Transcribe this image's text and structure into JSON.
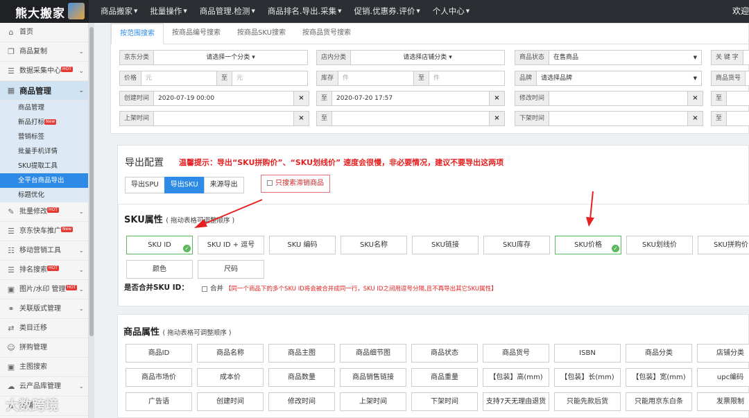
{
  "app": {
    "logo": "熊大搬家",
    "welcome": "欢迎"
  },
  "nav": [
    "商品搬家",
    "批量操作",
    "商品管理.检测",
    "商品排名.导出.采集",
    "促销.优惠券.评价",
    "个人中心"
  ],
  "sidebar": {
    "items": [
      {
        "label": "首页",
        "icon": "home-icon",
        "glyph": "⌂",
        "chevron": false,
        "hot": ""
      },
      {
        "label": "商品复制",
        "icon": "copy-icon",
        "glyph": "❐",
        "chevron": true,
        "hot": ""
      },
      {
        "label": "数据采集中心",
        "icon": "list-icon",
        "glyph": "☰",
        "chevron": true,
        "hot": "HOT"
      },
      {
        "label": "商品管理",
        "icon": "grid-icon",
        "glyph": "▦",
        "chevron": true,
        "hot": "",
        "active": true
      }
    ],
    "sub_items": [
      "商品管理",
      "新品打标",
      "营销标签",
      "批量手机详情",
      "SKU提取工具",
      "全平台商品导出",
      "标题优化"
    ],
    "sub_badge": "New",
    "items_after": [
      {
        "label": "批量修改",
        "icon": "wrench-icon",
        "glyph": "✎",
        "chevron": true,
        "hot": "HOT"
      },
      {
        "label": "京东快车推广",
        "icon": "list-icon",
        "glyph": "☰",
        "chevron": false,
        "hot": "New"
      },
      {
        "label": "移动营销工具",
        "icon": "sliders-icon",
        "glyph": "☷",
        "chevron": true,
        "hot": ""
      },
      {
        "label": "排名搜索",
        "icon": "list-icon",
        "glyph": "☰",
        "chevron": true,
        "hot": "HOT"
      },
      {
        "label": "图片/水印 管理",
        "icon": "image-icon",
        "glyph": "▣",
        "chevron": true,
        "hot": "HOT"
      },
      {
        "label": "关联版式管理",
        "icon": "link-icon",
        "glyph": "⚭",
        "chevron": true,
        "hot": ""
      },
      {
        "label": "类目迁移",
        "icon": "exchange-icon",
        "glyph": "⇄",
        "chevron": false,
        "hot": ""
      },
      {
        "label": "拼购管理",
        "icon": "users-icon",
        "glyph": "☺",
        "chevron": false,
        "hot": ""
      },
      {
        "label": "主图搜索",
        "icon": "picture-icon",
        "glyph": "▣",
        "chevron": false,
        "hot": ""
      },
      {
        "label": "云产品库管理",
        "icon": "cloud-icon",
        "glyph": "☁",
        "chevron": true,
        "hot": ""
      },
      {
        "label": "店铺",
        "icon": "store-icon",
        "glyph": "⌂",
        "chevron": false,
        "hot": ""
      }
    ]
  },
  "filters": {
    "tabs": [
      "按范围搜索",
      "按商品编号搜索",
      "按商品SKU搜索",
      "按商品货号搜索"
    ],
    "jd_category": {
      "label": "京东分类",
      "value": "请选择一个分类"
    },
    "shop_category": {
      "label": "店内分类",
      "value": "请选择店铺分类"
    },
    "status": {
      "label": "商品状态",
      "value": "在售商品"
    },
    "keyword": {
      "label": "关 键 字"
    },
    "price": {
      "label": "价格",
      "from_ph": "元",
      "to": "至",
      "to_ph": "元"
    },
    "stock": {
      "label": "库存",
      "from_ph": "件",
      "to": "至",
      "to_ph": "件"
    },
    "brand": {
      "label": "品牌",
      "value": "请选择品牌"
    },
    "sku_no": {
      "label": "商品货号"
    },
    "created": {
      "label": "创建时间",
      "from": "2020-07-19 00:00",
      "to": "至",
      "to_value": "2020-07-20 17:57"
    },
    "modified": {
      "label": "修改时间",
      "to": "至"
    },
    "listed": {
      "label": "上架时间",
      "to": "至"
    },
    "delisted": {
      "label": "下架时间",
      "to": "至"
    },
    "clear_glyph": "×"
  },
  "export": {
    "title": "导出配置",
    "tip": "温馨提示：导出“SKU拼购价”、“SKU划线价” 速度会很慢，非必要情况，建议不要导出这两项",
    "modes": [
      "导出SPU",
      "导出SKU",
      "来源导出"
    ],
    "active_mode": 1,
    "slow_only": "只搜索滞销商品",
    "sku_section": {
      "title": "SKU属性",
      "hint": "( 拖动表格可调整顺序 )"
    },
    "sku_attrs": [
      "SKU ID",
      "SKU ID + 逗号",
      "SKU 编码",
      "SKU名称",
      "SKU链接",
      "SKU库存",
      "SKU价格",
      "SKU划线价",
      "SKU拼购价",
      "颜色",
      "尺码"
    ],
    "sku_selected": [
      0,
      6
    ],
    "merge_label": "是否合并SKU ID：",
    "merge_option": "合并",
    "merge_note": "【同一个商品下的多个SKU ID将会被合并成同一行，SKU ID之间用逗号分隔,且不再导出其它SKU属性】"
  },
  "product": {
    "title": "商品属性",
    "hint": "( 拖动表格可调整顺序 )",
    "attrs": [
      "商品ID",
      "商品名称",
      "商品主图",
      "商品细节图",
      "商品状态",
      "商品货号",
      "ISBN",
      "商品分类",
      "店铺分类",
      "商品市场价",
      "成本价",
      "商品数量",
      "商品销售链接",
      "商品重量",
      "【包装】高(mm)",
      "【包装】长(mm)",
      "【包装】宽(mm)",
      "upc编码",
      "广告语",
      "创建时间",
      "修改时间",
      "上架时间",
      "下架时间",
      "支持7天无理由退货",
      "只能先款后货",
      "只能用京东白条",
      "发票限制"
    ]
  },
  "watermark": "大数跨境",
  "colors": {
    "accent": "#2d8ae6",
    "warning": "#e52020",
    "selected": "#5cb85c",
    "topbar": "#2b2e33"
  }
}
